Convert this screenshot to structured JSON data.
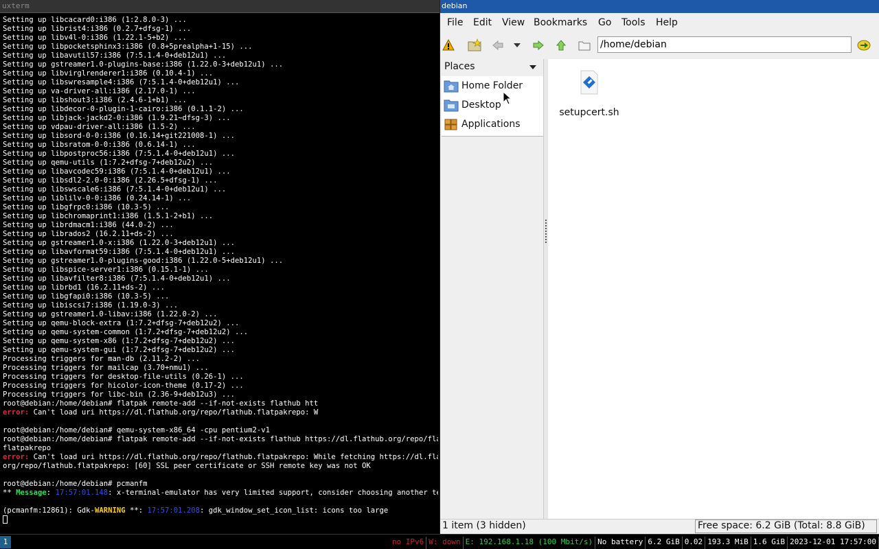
{
  "xterm": {
    "title": "uxterm",
    "lines": [
      [
        {
          "t": "Setting up libcacard0:i386 (1:2.8.0-3) ..."
        }
      ],
      [
        {
          "t": "Setting up librist4:i386 (0.2.7+dfsg-1) ..."
        }
      ],
      [
        {
          "t": "Setting up libv4l-0:i386 (1.22.1-5+b2) ..."
        }
      ],
      [
        {
          "t": "Setting up libpocketsphinx3:i386 (0.8+5prealpha+1-15) ..."
        }
      ],
      [
        {
          "t": "Setting up libavutil57:i386 (7:5.1.4-0+deb12u1) ..."
        }
      ],
      [
        {
          "t": "Setting up gstreamer1.0-plugins-base:i386 (1.22.0-3+deb12u1) ..."
        }
      ],
      [
        {
          "t": "Setting up libvirglrenderer1:i386 (0.10.4-1) ..."
        }
      ],
      [
        {
          "t": "Setting up libswresample4:i386 (7:5.1.4-0+deb12u1) ..."
        }
      ],
      [
        {
          "t": "Setting up va-driver-all:i386 (2.17.0-1) ..."
        }
      ],
      [
        {
          "t": "Setting up libshout3:i386 (2.4.6-1+b1) ..."
        }
      ],
      [
        {
          "t": "Setting up libdecor-0-plugin-1-cairo:i386 (0.1.1-2) ..."
        }
      ],
      [
        {
          "t": "Setting up libjack-jackd2-0:i386 (1.9.21~dfsg-3) ..."
        }
      ],
      [
        {
          "t": "Setting up vdpau-driver-all:i386 (1.5-2) ..."
        }
      ],
      [
        {
          "t": "Setting up libsord-0-0:i386 (0.16.14+git221008-1) ..."
        }
      ],
      [
        {
          "t": "Setting up libsratom-0-0:i386 (0.6.14-1) ..."
        }
      ],
      [
        {
          "t": "Setting up libpostproc56:i386 (7:5.1.4-0+deb12u1) ..."
        }
      ],
      [
        {
          "t": "Setting up qemu-utils (1:7.2+dfsg-7+deb12u2) ..."
        }
      ],
      [
        {
          "t": "Setting up libavcodec59:i386 (7:5.1.4-0+deb12u1) ..."
        }
      ],
      [
        {
          "t": "Setting up libsdl2-2.0-0:i386 (2.26.5+dfsg-1) ..."
        }
      ],
      [
        {
          "t": "Setting up libswscale6:i386 (7:5.1.4-0+deb12u1) ..."
        }
      ],
      [
        {
          "t": "Setting up liblilv-0-0:i386 (0.24.14-1) ..."
        }
      ],
      [
        {
          "t": "Setting up libgfrpc0:i386 (10.3-5) ..."
        }
      ],
      [
        {
          "t": "Setting up libchromaprint1:i386 (1.5.1-2+b1) ..."
        }
      ],
      [
        {
          "t": "Setting up librdmacm1:i386 (44.0-2) ..."
        }
      ],
      [
        {
          "t": "Setting up librados2 (16.2.11+ds-2) ..."
        }
      ],
      [
        {
          "t": "Setting up gstreamer1.0-x:i386 (1.22.0-3+deb12u1) ..."
        }
      ],
      [
        {
          "t": "Setting up libavformat59:i386 (7:5.1.4-0+deb12u1) ..."
        }
      ],
      [
        {
          "t": "Setting up gstreamer1.0-plugins-good:i386 (1.22.0-5+deb12u1) ..."
        }
      ],
      [
        {
          "t": "Setting up libspice-server1:i386 (0.15.1-1) ..."
        }
      ],
      [
        {
          "t": "Setting up libavfilter8:i386 (7:5.1.4-0+deb12u1) ..."
        }
      ],
      [
        {
          "t": "Setting up librbd1 (16.2.11+ds-2) ..."
        }
      ],
      [
        {
          "t": "Setting up libgfapi0:i386 (10.3-5) ..."
        }
      ],
      [
        {
          "t": "Setting up libiscsi7:i386 (1.19.0-3) ..."
        }
      ],
      [
        {
          "t": "Setting up gstreamer1.0-libav:i386 (1.22.0-2) ..."
        }
      ],
      [
        {
          "t": "Setting up qemu-block-extra (1:7.2+dfsg-7+deb12u2) ..."
        }
      ],
      [
        {
          "t": "Setting up qemu-system-common (1:7.2+dfsg-7+deb12u2) ..."
        }
      ],
      [
        {
          "t": "Setting up qemu-system-x86 (1:7.2+dfsg-7+deb12u2) ..."
        }
      ],
      [
        {
          "t": "Setting up qemu-system-gui (1:7.2+dfsg-7+deb12u2) ..."
        }
      ],
      [
        {
          "t": "Processing triggers for man-db (2.11.2-2) ..."
        }
      ],
      [
        {
          "t": "Processing triggers for mailcap (3.70+nmu1) ..."
        }
      ],
      [
        {
          "t": "Processing triggers for desktop-file-utils (0.26-1) ..."
        }
      ],
      [
        {
          "t": "Processing triggers for hicolor-icon-theme (0.17-2) ..."
        }
      ],
      [
        {
          "t": "Processing triggers for libc-bin (2.36-9+deb12u3) ..."
        }
      ],
      [
        {
          "t": "root@debian:/home/debian# flatpak remote-add --if-not-exists flathub htt"
        }
      ],
      [
        {
          "t": "error:",
          "c": "red"
        },
        {
          "t": " Can't load uri https://dl.flathub.org/repo/flathub.flatpakrepo: W"
        }
      ],
      [
        {
          "t": ""
        }
      ],
      [
        {
          "t": "root@debian:/home/debian# qemu-system-x86_64 -cpu pentium2-v1"
        }
      ],
      [
        {
          "t": "root@debian:/home/debian# flatpak remote-add --if-not-exists flathub https://dl.flathub.org/repo/flathub."
        }
      ],
      [
        {
          "t": "flatpakrepo"
        }
      ],
      [
        {
          "t": "error:",
          "c": "red"
        },
        {
          "t": " Can't load uri https://dl.flathub.org/repo/flathub.flatpakrepo: While fetching https://dl.flathub."
        }
      ],
      [
        {
          "t": "org/repo/flathub.flatpakrepo: [60] SSL peer certificate or SSH remote key was not OK"
        }
      ],
      [
        {
          "t": ""
        }
      ],
      [
        {
          "t": "root@debian:/home/debian# pcmanfm"
        }
      ],
      [
        {
          "t": "** "
        },
        {
          "t": "Message",
          "c": "green"
        },
        {
          "t": ": "
        },
        {
          "t": "17:57:01.148",
          "c": "blue"
        },
        {
          "t": ": x-terminal-emulator has very limited support, consider choosing another termina"
        }
      ],
      [
        {
          "t": ""
        }
      ],
      [
        {
          "t": "(pcmanfm:12861): Gdk-"
        },
        {
          "t": "WARNING",
          "c": "yellow"
        },
        {
          "t": " **: "
        },
        {
          "t": "17:57:01.208",
          "c": "blue"
        },
        {
          "t": ": gdk_window_set_icon_list: icons too large"
        }
      ],
      [
        {
          "t": "",
          "cursor": true
        }
      ]
    ]
  },
  "filemanager": {
    "title": "debian",
    "menu": [
      "File",
      "Edit",
      "View",
      "Bookmarks",
      "Go",
      "Tools",
      "Help"
    ],
    "path": "/home/debian",
    "places_header": "Places",
    "places": [
      {
        "label": "Home Folder",
        "icon": "home-folder-icon"
      },
      {
        "label": "Desktop",
        "icon": "desktop-folder-icon"
      },
      {
        "label": "Applications",
        "icon": "applications-icon"
      }
    ],
    "files": [
      {
        "name": "setupcert.sh",
        "icon": "shell-script-icon"
      }
    ],
    "status_left": "1 item (3 hidden)",
    "status_right": "Free space: 6.2 GiB (Total: 8.8 GiB)"
  },
  "panel": {
    "workspace": "1",
    "items": [
      {
        "text": "no IPv6",
        "color": "#d02030"
      },
      {
        "text": "W: down",
        "color": "#d02030"
      },
      {
        "text": "E: 192.168.1.18 (100 Mbit/s)",
        "color": "#2ad050"
      },
      {
        "text": "No battery",
        "color": "#ffffff"
      },
      {
        "text": "6.2 GiB",
        "color": "#ffffff"
      },
      {
        "text": "0.02",
        "color": "#ffffff"
      },
      {
        "text": "193.3 MiB",
        "color": "#ffffff"
      },
      {
        "text": "1.6 GiB",
        "color": "#ffffff"
      },
      {
        "text": "2023-12-01 17:57:00",
        "color": "#ffffff"
      }
    ]
  }
}
